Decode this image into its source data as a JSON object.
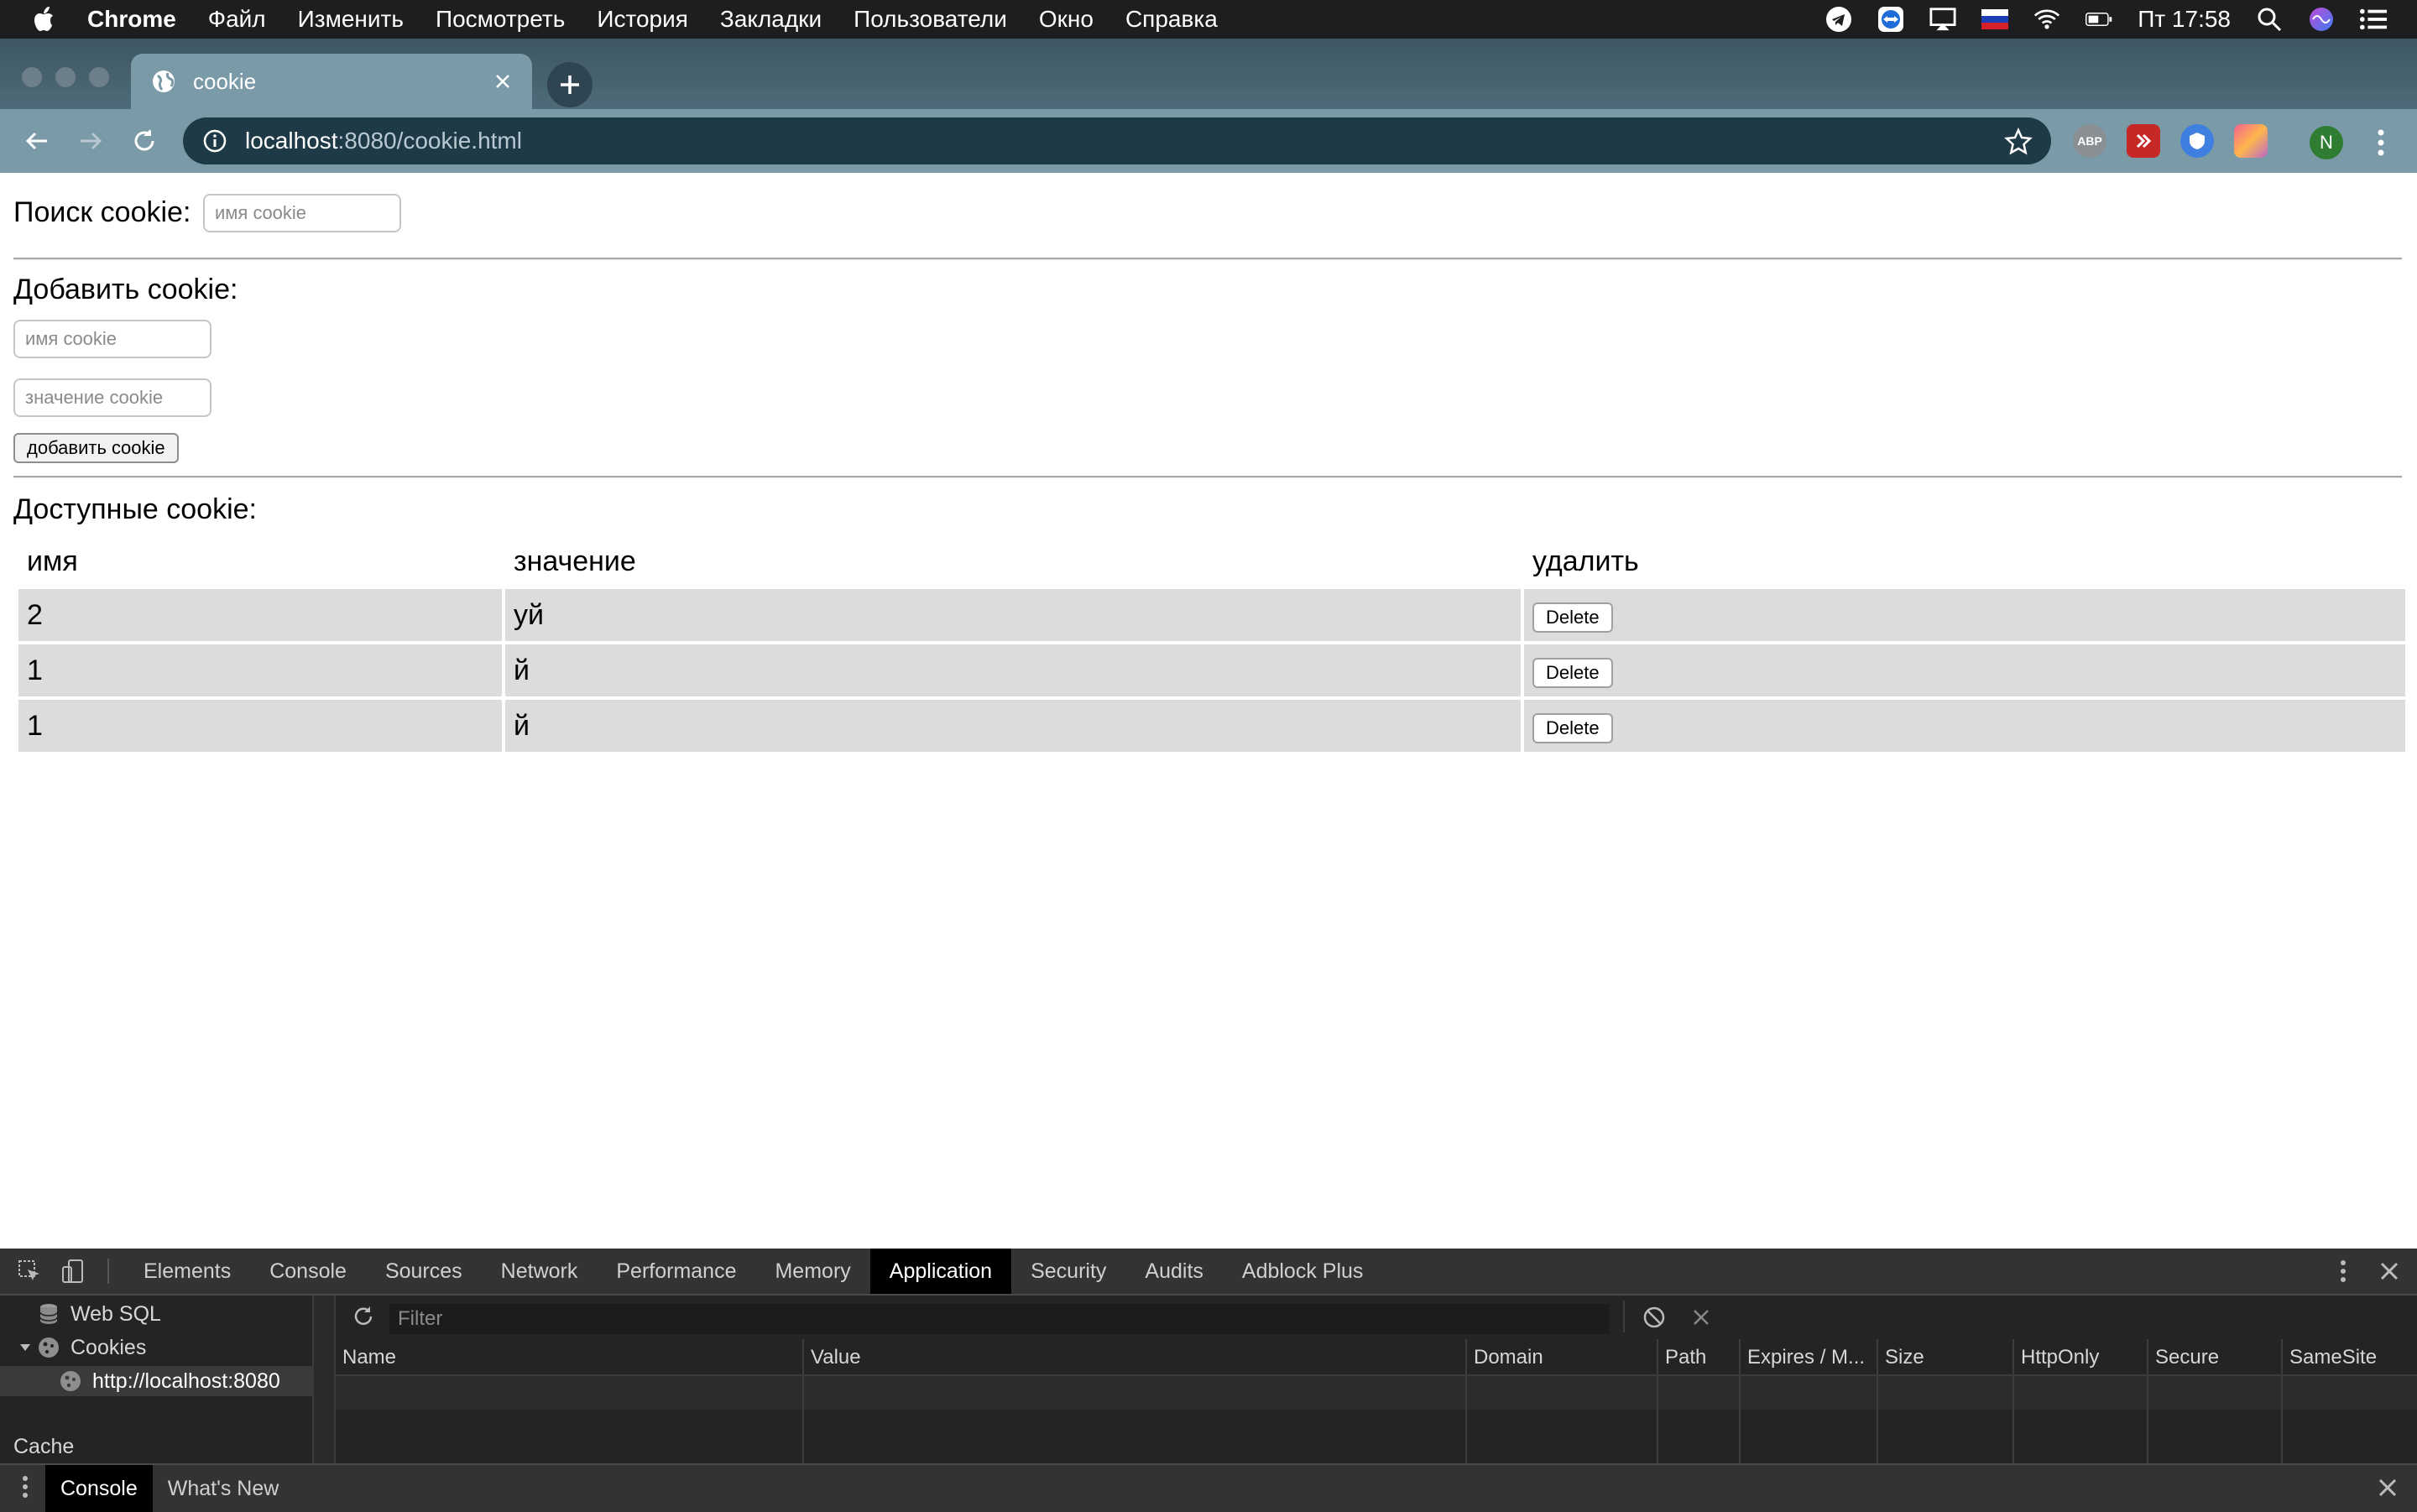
{
  "menubar": {
    "items": [
      "Chrome",
      "Файл",
      "Изменить",
      "Посмотреть",
      "История",
      "Закладки",
      "Пользователи",
      "Окно",
      "Справка"
    ],
    "clock": "Пт 17:58"
  },
  "browser": {
    "tab_title": "cookie",
    "url_host": "localhost",
    "url_rest": ":8080/cookie.html",
    "profile_initial": "N",
    "extensions": [
      "ABP"
    ]
  },
  "page": {
    "search_label": "Поиск cookie:",
    "search_placeholder": "имя cookie",
    "add_label": "Добавить cookie:",
    "add_name_placeholder": "имя cookie",
    "add_value_placeholder": "значение cookie",
    "add_button": "добавить cookie",
    "available_label": "Доступные cookie:",
    "table": {
      "headers": [
        "имя",
        "значение",
        "удалить"
      ],
      "rows": [
        {
          "name": "2",
          "value": "уй",
          "action": "Delete"
        },
        {
          "name": "1",
          "value": "й",
          "action": "Delete"
        },
        {
          "name": "1",
          "value": "й",
          "action": "Delete"
        }
      ]
    }
  },
  "devtools": {
    "tabs": [
      "Elements",
      "Console",
      "Sources",
      "Network",
      "Performance",
      "Memory",
      "Application",
      "Security",
      "Audits",
      "Adblock Plus"
    ],
    "active_tab": "Application",
    "sidebar": {
      "web_sql": "Web SQL",
      "cookies": "Cookies",
      "cookie_origin": "http://localhost:8080",
      "cache": "Cache"
    },
    "filter_placeholder": "Filter",
    "columns": [
      "Name",
      "Value",
      "Domain",
      "Path",
      "Expires / M...",
      "Size",
      "HttpOnly",
      "Secure",
      "SameSite"
    ],
    "drawer_tabs": [
      "Console",
      "What's New"
    ]
  },
  "colors": {
    "menubar_bg": "#1e1e20",
    "toolbar_bg": "#7b9aa7",
    "omnibox_bg": "#1f3a47",
    "table_cell_bg": "#dcdcdc",
    "devtools_bg": "#242424"
  }
}
